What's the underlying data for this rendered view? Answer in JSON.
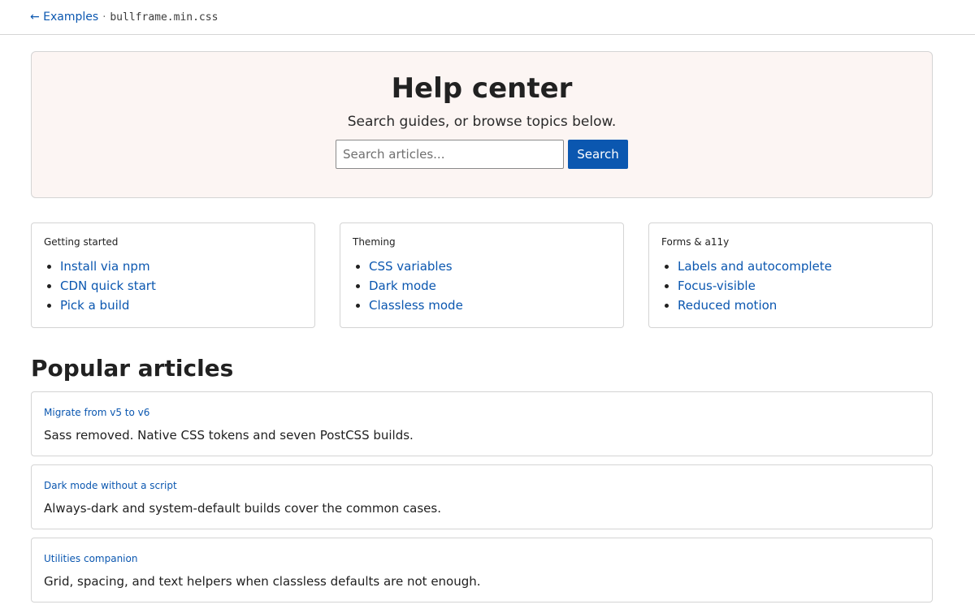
{
  "topbar": {
    "back_label": "← Examples",
    "separator": "·",
    "filename": "bullframe.min.css"
  },
  "hero": {
    "title": "Help center",
    "subtitle": "Search guides, or browse topics below.",
    "search_placeholder": "Search articles...",
    "search_button": "Search"
  },
  "topics": [
    {
      "title": "Getting started",
      "links": [
        "Install via npm",
        "CDN quick start",
        "Pick a build"
      ]
    },
    {
      "title": "Theming",
      "links": [
        "CSS variables",
        "Dark mode",
        "Classless mode"
      ]
    },
    {
      "title": "Forms & a11y",
      "links": [
        "Labels and autocomplete",
        "Focus-visible",
        "Reduced motion"
      ]
    }
  ],
  "popular": {
    "heading": "Popular articles",
    "articles": [
      {
        "title": "Migrate from v5 to v6",
        "description": "Sass removed. Native CSS tokens and seven PostCSS builds."
      },
      {
        "title": "Dark mode without a script",
        "description": "Always-dark and system-default builds cover the common cases."
      },
      {
        "title": "Utilities companion",
        "description": "Grid, spacing, and text helpers when classless defaults are not enough."
      }
    ]
  },
  "colors": {
    "link": "#0b57b0",
    "hero_bg": "#fcf5f3",
    "button_bg": "#0b57b0"
  }
}
